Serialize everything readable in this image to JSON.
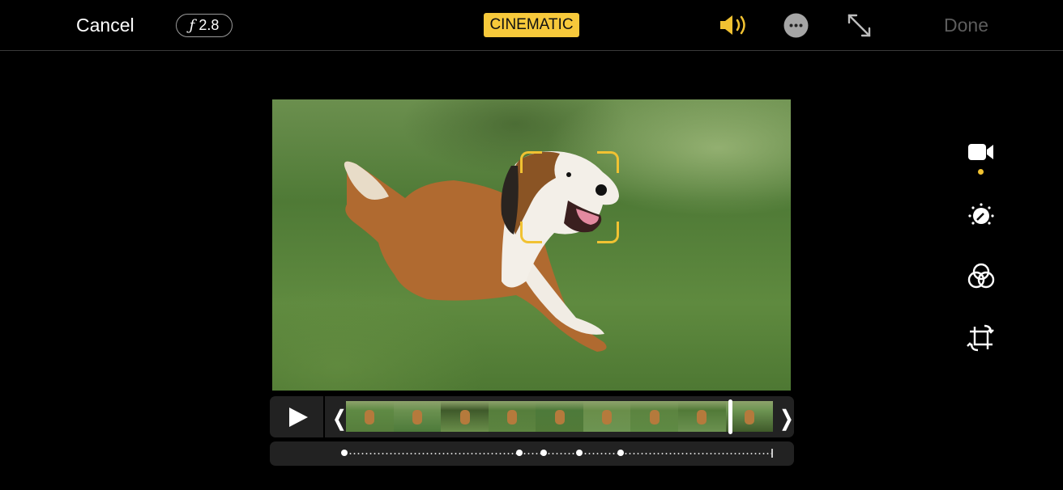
{
  "toolbar": {
    "cancel_label": "Cancel",
    "aperture_symbol": "ƒ",
    "aperture_value": "2.8",
    "mode_badge": "CINEMATIC",
    "done_label": "Done",
    "icons": [
      "speaker-icon",
      "more-icon",
      "expand-icon"
    ]
  },
  "colors": {
    "accent": "#f7c93b",
    "focus_box": "#f1c232",
    "done_disabled": "#5d5d5d",
    "panel": "#222222"
  },
  "viewer": {
    "subject": "dog lying on grass",
    "focus_tracking": true
  },
  "timeline": {
    "playhead_position": 0.9,
    "frames": 9,
    "focus_keyframes": [
      0.0,
      0.41,
      0.465,
      0.55,
      0.645
    ]
  },
  "side_tools": [
    {
      "name": "video",
      "selected": true
    },
    {
      "name": "adjust",
      "selected": false
    },
    {
      "name": "filters",
      "selected": false
    },
    {
      "name": "crop",
      "selected": false
    }
  ]
}
